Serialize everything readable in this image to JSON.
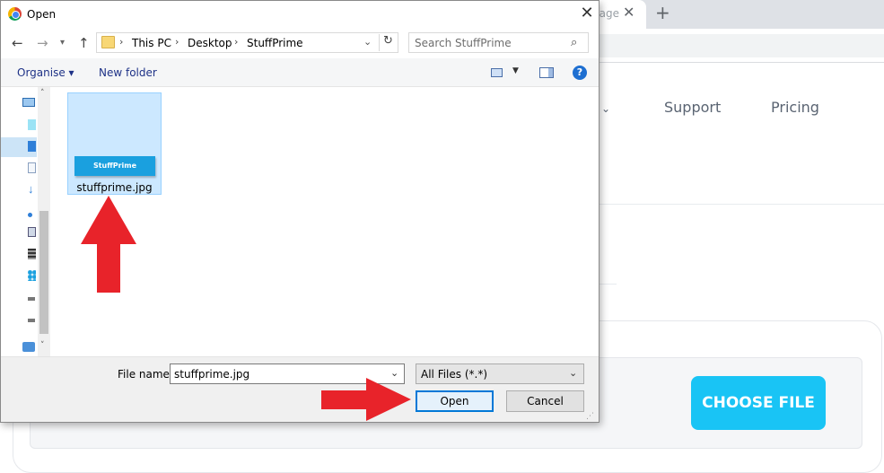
{
  "dialog": {
    "title": "Open",
    "close_icon": "close-icon",
    "breadcrumb": [
      "This PC",
      "Desktop",
      "StuffPrime"
    ],
    "search_placeholder": "Search StuffPrime",
    "commands": {
      "organise": "Organise ▾",
      "new_folder": "New folder"
    },
    "files": [
      {
        "name": "stuffprime.jpg",
        "thumbnail_text": "StuffPrime",
        "selected": true
      }
    ],
    "file_name_label": "File name:",
    "file_name_value": "stuffprime.jpg",
    "file_type_filter": "All Files (*.*)",
    "open_label": "Open",
    "cancel_label": "Cancel"
  },
  "background_page": {
    "tab_partial_title": "nage",
    "nav": {
      "support": "Support",
      "pricing": "Pricing"
    },
    "choose_file_label": "CHOOSE FILE",
    "accent_color": "#19c4f5"
  },
  "annotations": {
    "arrow_color": "#e8232a",
    "arrows": [
      "arrow-up-to-file",
      "arrow-right-to-open"
    ]
  }
}
